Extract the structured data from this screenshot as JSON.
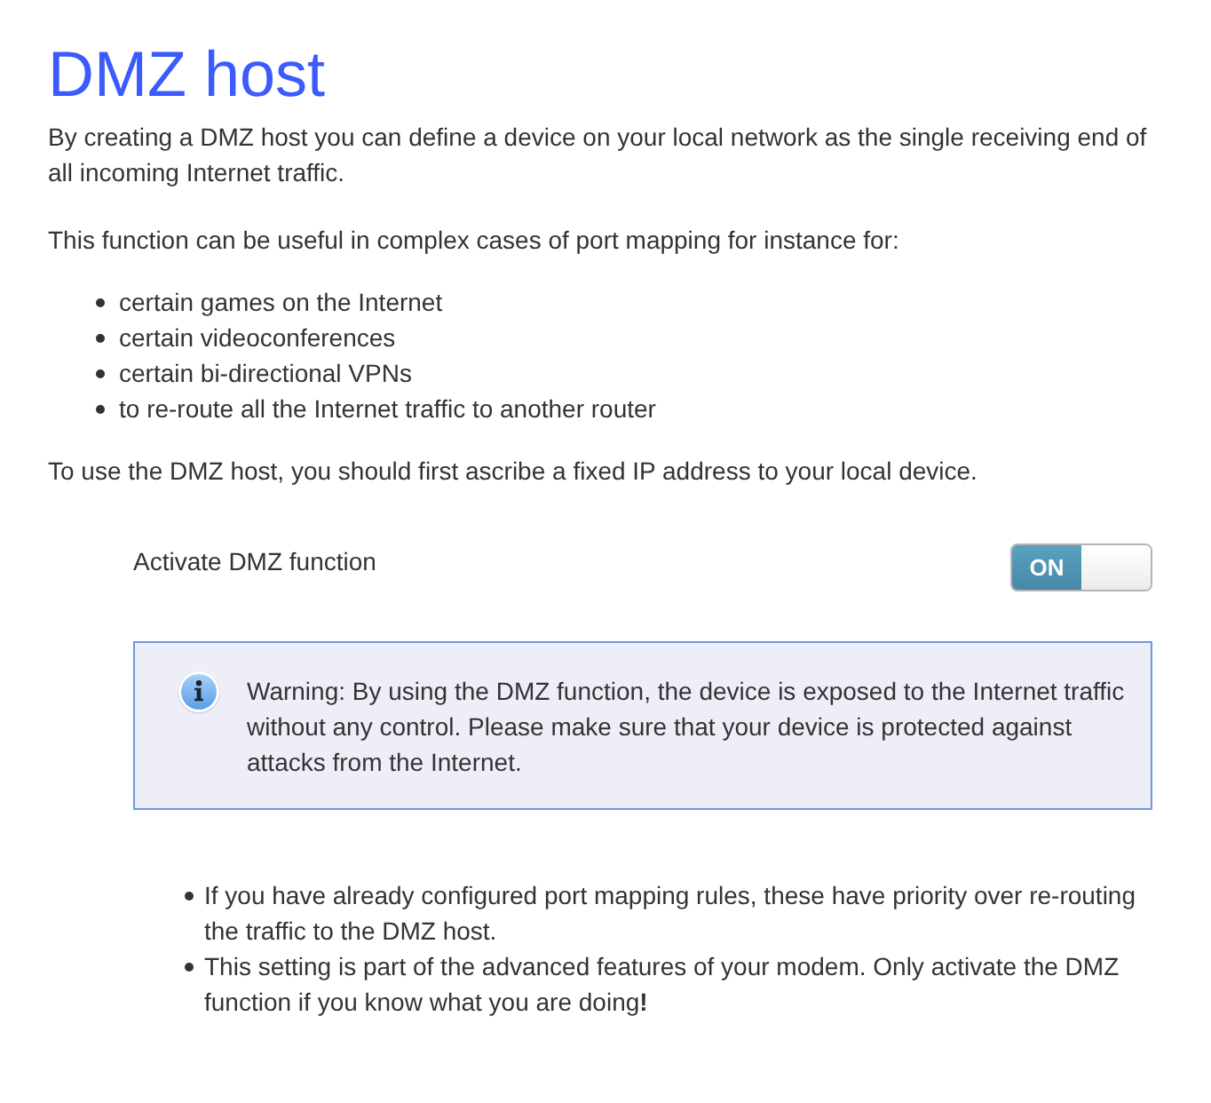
{
  "title": "DMZ host",
  "intro": "By creating a DMZ host you can define a device on your local network as the single receiving end of all incoming Internet traffic.",
  "usage_intro": "This function can be useful in complex cases of port mapping for instance for:",
  "use_cases": [
    "certain games on the Internet",
    "certain videoconferences",
    "certain bi-directional VPNs",
    "to re-route all the Internet traffic to another router"
  ],
  "prerequisite": "To use the DMZ host, you should first ascribe a fixed IP address to your local device.",
  "dmz_setting": {
    "label": "Activate DMZ function",
    "toggle": {
      "text": "ON",
      "on": true
    }
  },
  "warning": {
    "text": "Warning: By using the DMZ function, the device is exposed to the Internet traffic without any control. Please make sure that your device is protected against attacks from the Internet."
  },
  "notes": [
    "If you have already configured port mapping rules, these have priority over re-routing the traffic to the DMZ host.",
    "This setting is part of the advanced features of your modem. Only activate the DMZ function if you know what you are doing**!**"
  ]
}
